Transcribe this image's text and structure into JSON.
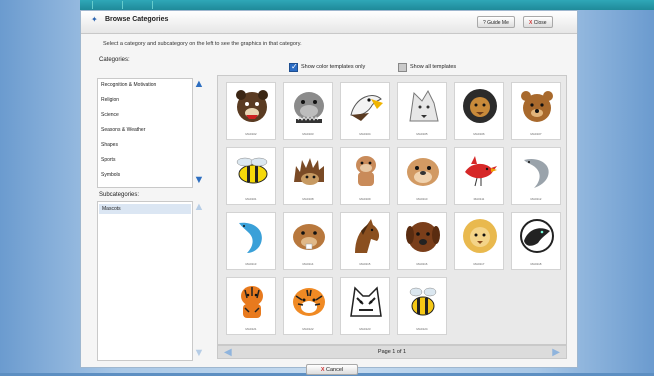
{
  "header": {
    "title": "Browse Categories",
    "guide_label": "Guide Me",
    "close_label": "Close"
  },
  "instructions": "Select a category and subcategory on the left to see the graphics in that category.",
  "categories_label": "Categories:",
  "categories": [
    "Recognition & Motivation",
    "Religion",
    "Science",
    "Seasons & Weather",
    "Shapes",
    "Sports",
    "Symbols"
  ],
  "subcategories_label": "Subcategories:",
  "subcategories": [
    "Mascots"
  ],
  "options": {
    "color_only": "Show color templates only",
    "all": "Show all templates"
  },
  "pager": "Page 1 of 1",
  "cancel_label": "Cancel",
  "thumbnails": [
    {
      "name": "bear-mascot",
      "caption": "MA0102"
    },
    {
      "name": "bulldog-spiked-collar-mascot",
      "caption": "MA0103"
    },
    {
      "name": "eagle-mascot",
      "caption": "MA0104"
    },
    {
      "name": "wolf-mascot",
      "caption": "MA0105"
    },
    {
      "name": "lion-mascot",
      "caption": "MA0106"
    },
    {
      "name": "brown-bear-mascot",
      "caption": "MA0107"
    },
    {
      "name": "hornet-mascot",
      "caption": "MA0101"
    },
    {
      "name": "hedgehog-mascot",
      "caption": "MA0108"
    },
    {
      "name": "bulldog-standing-mascot",
      "caption": "MA0109"
    },
    {
      "name": "bulldog-face-mascot",
      "caption": "MA0110"
    },
    {
      "name": "cardinal-mascot",
      "caption": "MA0111"
    },
    {
      "name": "dolphin-mascot",
      "caption": "MA0112"
    },
    {
      "name": "dolphin-blue-mascot",
      "caption": "MA0113"
    },
    {
      "name": "beaver-mascot",
      "caption": "MA0114"
    },
    {
      "name": "horse-mascot",
      "caption": "MA0115"
    },
    {
      "name": "brown-dog-mascot",
      "caption": "MA0116"
    },
    {
      "name": "lion-face-mascot",
      "caption": "MA0117"
    },
    {
      "name": "panther-mascot",
      "caption": "MA0118"
    },
    {
      "name": "tiger-full-mascot",
      "caption": "MA0121"
    },
    {
      "name": "tiger-face-mascot",
      "caption": "MA0122"
    },
    {
      "name": "wildcat-mascot",
      "caption": "MA0123"
    },
    {
      "name": "bee-mascot",
      "caption": "MA0124"
    }
  ],
  "colors": {
    "accent": "#2b6cc4",
    "teal": "#1f8a99"
  }
}
